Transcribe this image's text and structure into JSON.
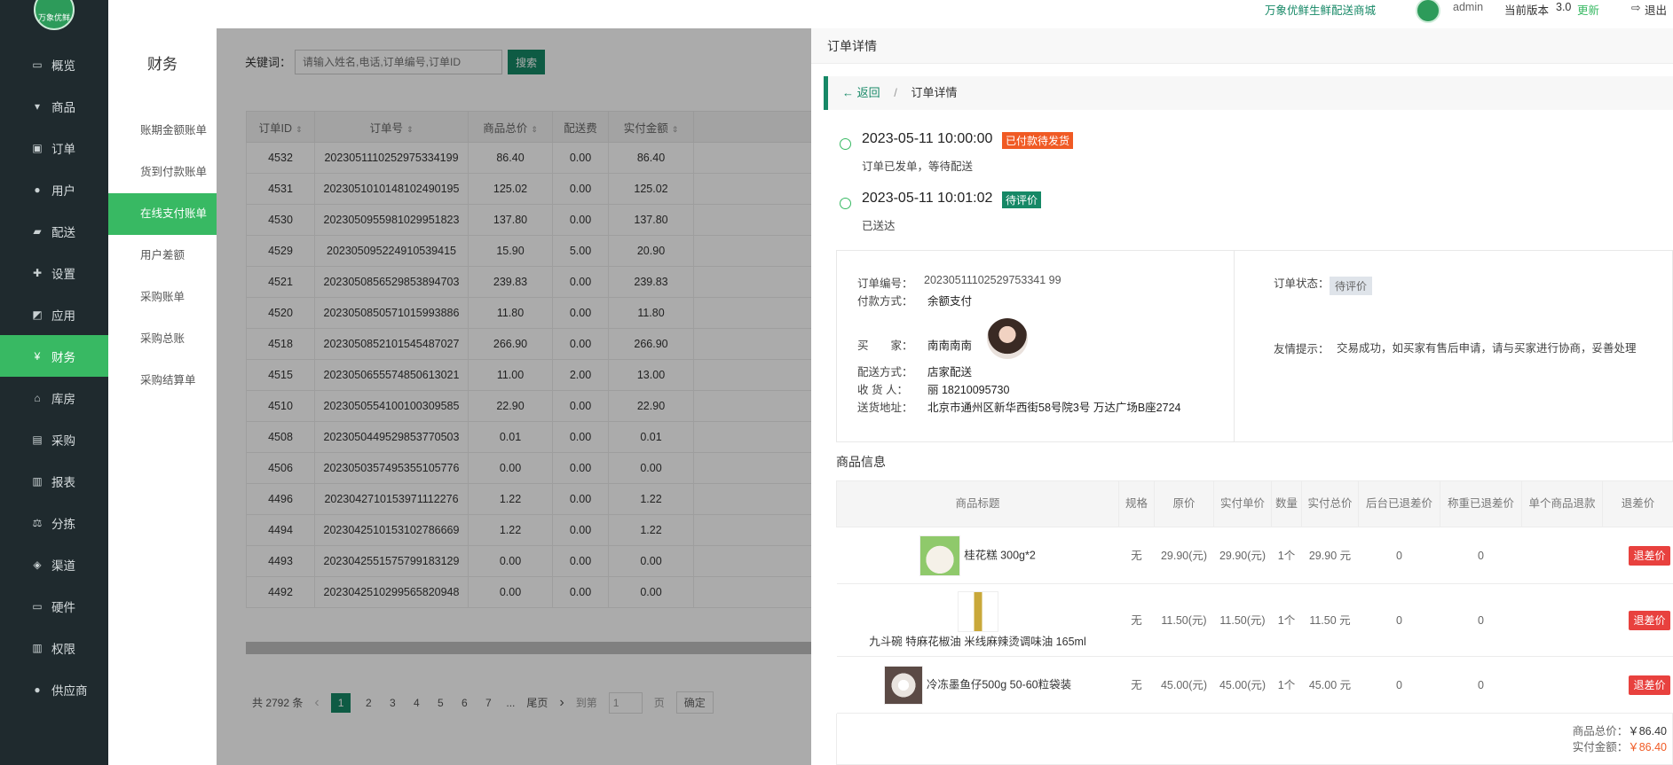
{
  "sidebar": {
    "logo_text": "万象优鲜",
    "items": [
      {
        "label": "概览",
        "icon": "monitor-icon",
        "glyph": "▭"
      },
      {
        "label": "商品",
        "icon": "cart-icon",
        "glyph": "▾"
      },
      {
        "label": "订单",
        "icon": "money-icon",
        "glyph": "▣"
      },
      {
        "label": "用户",
        "icon": "users-icon",
        "glyph": "●"
      },
      {
        "label": "配送",
        "icon": "truck-icon",
        "glyph": "▰"
      },
      {
        "label": "设置",
        "icon": "puzzle-icon",
        "glyph": "✚"
      },
      {
        "label": "应用",
        "icon": "apps-icon",
        "glyph": "◩"
      },
      {
        "label": "财务",
        "icon": "yen-icon",
        "glyph": "¥",
        "active": true
      },
      {
        "label": "库房",
        "icon": "warehouse-icon",
        "glyph": "⌂"
      },
      {
        "label": "采购",
        "icon": "train-icon",
        "glyph": "▤"
      },
      {
        "label": "报表",
        "icon": "chart-icon",
        "glyph": "▥"
      },
      {
        "label": "分拣",
        "icon": "balance-icon",
        "glyph": "⚖"
      },
      {
        "label": "渠道",
        "icon": "cube-icon",
        "glyph": "◈"
      },
      {
        "label": "硬件",
        "icon": "desktop-icon",
        "glyph": "▭"
      },
      {
        "label": "权限",
        "icon": "bank-icon",
        "glyph": "▥"
      },
      {
        "label": "供应商",
        "icon": "supplier-icon",
        "glyph": "●"
      }
    ]
  },
  "subnav": {
    "title": "财务",
    "items": [
      {
        "label": "账期金额账单"
      },
      {
        "label": "货到付款账单"
      },
      {
        "label": "在线支付账单",
        "active": true
      },
      {
        "label": "用户差额"
      },
      {
        "label": "采购账单"
      },
      {
        "label": "采购总账"
      },
      {
        "label": "采购结算单"
      }
    ]
  },
  "topbar": {
    "brand": "万象优鲜生鲜配送商城",
    "user": "admin",
    "version_label": "当前版本",
    "version": "3.0",
    "update": "更新",
    "logout": "退出",
    "logout_icon": "logout-icon"
  },
  "search": {
    "label": "关键词：",
    "placeholder": "请输入姓名,电话,订单编号,订单ID",
    "button": "搜索"
  },
  "orders": {
    "columns": [
      "订单ID",
      "订单号",
      "商品总价",
      "配送费",
      "实付金额"
    ],
    "rows": [
      [
        "4532",
        "20230511102529753341​99",
        "86.40",
        "0.00",
        "86.40"
      ],
      [
        "4531",
        "20230510101481024901​95",
        "125.02",
        "0.00",
        "125.02"
      ],
      [
        "4530",
        "20230509559810299518​23",
        "137.80",
        "0.00",
        "137.80"
      ],
      [
        "4529",
        "20230509522491053941​5",
        "15.90",
        "5.00",
        "20.90"
      ],
      [
        "4521",
        "20230508565298538947​03",
        "239.83",
        "0.00",
        "239.83"
      ],
      [
        "4520",
        "20230508505710159938​86",
        "11.80",
        "0.00",
        "11.80"
      ],
      [
        "4518",
        "20230508521015454870​27",
        "266.90",
        "0.00",
        "266.90"
      ],
      [
        "4515",
        "20230506555748506130​21",
        "11.00",
        "2.00",
        "13.00"
      ],
      [
        "4510",
        "20230505541001003095​85",
        "22.90",
        "0.00",
        "22.90"
      ],
      [
        "4508",
        "20230504495298537705​03",
        "0.01",
        "0.00",
        "0.01"
      ],
      [
        "4506",
        "20230503574953551057​76",
        "0.00",
        "0.00",
        "0.00"
      ],
      [
        "4496",
        "20230427101539711122​76",
        "1.22",
        "0.00",
        "1.22"
      ],
      [
        "4494",
        "20230425101531027866​69",
        "1.22",
        "0.00",
        "1.22"
      ],
      [
        "4493",
        "20230425515757991831​29",
        "0.00",
        "0.00",
        "0.00"
      ],
      [
        "4492",
        "20230425102995658209​48",
        "0.00",
        "0.00",
        "0.00"
      ]
    ]
  },
  "pager": {
    "total": "共 2792 条",
    "prev": "‹",
    "pages": [
      "1",
      "2",
      "3",
      "4",
      "5",
      "6",
      "7"
    ],
    "ellipsis": "...",
    "last": "尾页",
    "next": "›",
    "goto": "到第",
    "goto_value": "1",
    "page_unit": "页",
    "confirm": "确定"
  },
  "drawer": {
    "title": "订单详情",
    "back": "返回",
    "sep": "/",
    "crumb": "订单详情",
    "timeline": [
      {
        "time": "2023-05-11 10:00:00",
        "tag": "已付款待发货",
        "tag_color": "#f05a24",
        "note": "订单已发单，等待配送"
      },
      {
        "time": "2023-05-11 10:01:02",
        "tag": "待评价",
        "tag_color": "#168866",
        "note": "已送达"
      }
    ],
    "info": {
      "order_no_label": "订单编号：",
      "order_no": "20230511102529753341 99",
      "pay_label": "付款方式：",
      "pay": "余额支付",
      "buyer_label": "买　　家：",
      "buyer": "南南南南",
      "delivery_label": "配送方式：",
      "delivery": "店家配送",
      "receiver_label": "收 货 人：",
      "receiver": "丽 18210095730",
      "address_label": "送货地址：",
      "address": "北京市通州区新华西街58号院3号 万达广场B座2724",
      "status_label": "订单状态：",
      "status": "待评价",
      "tip_label": "友情提示：",
      "tip": "交易成功，如买家有售后申请，请与买家进行协商，妥善处理"
    },
    "goods_title": "商品信息",
    "goods_columns": [
      "商品标题",
      "规格",
      "原价",
      "实付单价",
      "数量",
      "实付总价",
      "后台已退差价",
      "称重已退差价",
      "单个商品退款",
      "退差价"
    ],
    "goods": [
      {
        "title": "桂花糕 300g*2",
        "spec": "无",
        "price": "29.90(元)",
        "unit": "29.90(元)",
        "qty": "1个",
        "total": "29.90 元",
        "bg": "0",
        "wg": "0",
        "single": "",
        "btn": "退差价"
      },
      {
        "title": "九斗碗 特麻花椒油 米线麻辣烫调味油 165ml",
        "spec": "无",
        "price": "11.50(元)",
        "unit": "11.50(元)",
        "qty": "1个",
        "total": "11.50 元",
        "bg": "0",
        "wg": "0",
        "single": "",
        "btn": "退差价"
      },
      {
        "title": "冷冻墨鱼仔500g 50-60粒袋装",
        "spec": "无",
        "price": "45.00(元)",
        "unit": "45.00(元)",
        "qty": "1个",
        "total": "45.00 元",
        "bg": "0",
        "wg": "0",
        "single": "",
        "btn": "退差价"
      }
    ],
    "totals": {
      "goods_label": "商品总价：",
      "goods": "￥86.40",
      "paid_label": "实付金额：",
      "paid": "￥86.40"
    }
  },
  "colors": {
    "accent": "#168866",
    "active": "#38b963",
    "danger": "#e8413e",
    "warn": "#f05a24"
  }
}
